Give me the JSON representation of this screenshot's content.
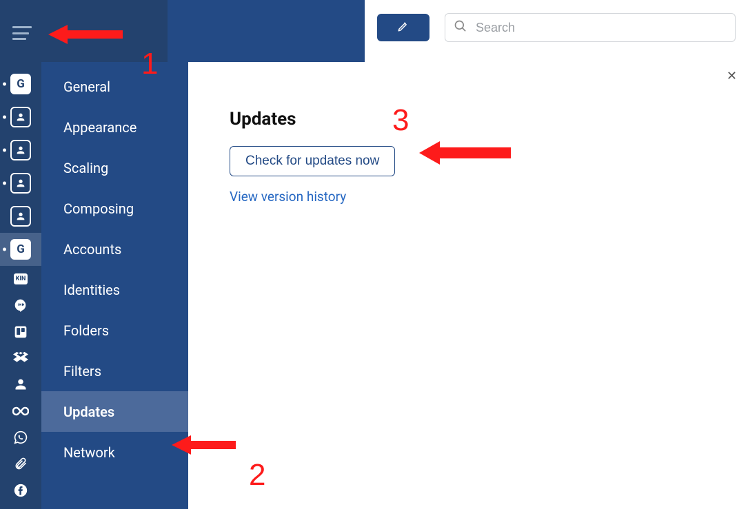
{
  "header": {
    "search_placeholder": "Search"
  },
  "rail": {
    "items": [
      {
        "type": "g-white",
        "dot": true
      },
      {
        "type": "person-outline",
        "dot": true
      },
      {
        "type": "person-outline",
        "dot": true
      },
      {
        "type": "person-outline",
        "dot": true
      },
      {
        "type": "person-outline",
        "dot": false
      },
      {
        "type": "g-white-active",
        "dot": true
      },
      {
        "type": "kin",
        "dot": false
      },
      {
        "type": "hangouts",
        "dot": false
      },
      {
        "type": "trello",
        "dot": false
      },
      {
        "type": "dropbox",
        "dot": false
      },
      {
        "type": "person-solid",
        "dot": false
      },
      {
        "type": "infinity",
        "dot": false
      },
      {
        "type": "whatsapp",
        "dot": false
      },
      {
        "type": "attachment",
        "dot": false
      },
      {
        "type": "facebook",
        "dot": false
      }
    ]
  },
  "sidebar": {
    "items": [
      {
        "label": "General"
      },
      {
        "label": "Appearance"
      },
      {
        "label": "Scaling"
      },
      {
        "label": "Composing"
      },
      {
        "label": "Accounts"
      },
      {
        "label": "Identities"
      },
      {
        "label": "Folders"
      },
      {
        "label": "Filters"
      },
      {
        "label": "Updates"
      },
      {
        "label": "Network"
      }
    ],
    "active_index": 8
  },
  "content": {
    "heading": "Updates",
    "check_button": "Check for updates now",
    "version_link": "View version history"
  },
  "annotations": {
    "num1": "1",
    "num2": "2",
    "num3": "3"
  }
}
